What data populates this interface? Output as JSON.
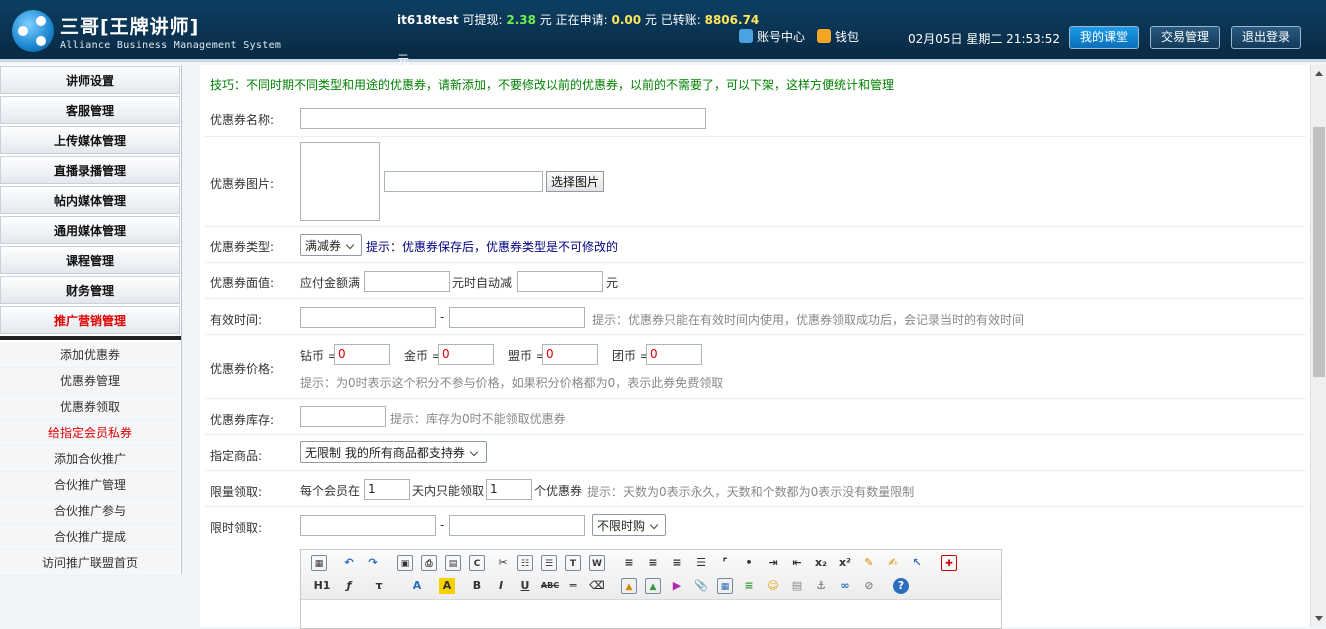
{
  "header": {
    "logo_title": "三哥[王牌讲师]",
    "logo_subtitle": "Alliance Business Management System",
    "username": "it618test",
    "withdraw_label": "可提现:",
    "withdraw_value": "2.38",
    "applying_label": "元 正在申请:",
    "applying_value": "0.00",
    "transferred_label": "元 已转账:",
    "transferred_value": "8806.74",
    "yuan": "元",
    "account_center": "账号中心",
    "wallet": "钱包",
    "date_text": "02月05日 星期二 21:53:52",
    "btn_my_class": "我的课堂",
    "btn_trade": "交易管理",
    "btn_logout": "退出登录"
  },
  "sidebar": {
    "menu": [
      {
        "label": "讲师设置",
        "active": false
      },
      {
        "label": "客服管理",
        "active": false
      },
      {
        "label": "上传媒体管理",
        "active": false
      },
      {
        "label": "直播录播管理",
        "active": false
      },
      {
        "label": "帖内媒体管理",
        "active": false
      },
      {
        "label": "通用媒体管理",
        "active": false
      },
      {
        "label": "课程管理",
        "active": false
      },
      {
        "label": "财务管理",
        "active": false
      },
      {
        "label": "推广营销管理",
        "active": true
      }
    ],
    "sub": [
      {
        "label": "添加优惠券",
        "active": false
      },
      {
        "label": "优惠券管理",
        "active": false
      },
      {
        "label": "优惠券领取",
        "active": false
      },
      {
        "label": "给指定会员私券",
        "active": true
      },
      {
        "label": "添加合伙推广",
        "active": false
      },
      {
        "label": "合伙推广管理",
        "active": false
      },
      {
        "label": "合伙推广参与",
        "active": false
      },
      {
        "label": "合伙推广提成",
        "active": false
      },
      {
        "label": "访问推广联盟首页",
        "active": false
      }
    ]
  },
  "form": {
    "tip": "技巧：不同时期不同类型和用途的优惠券，请新添加，不要修改以前的优惠券，以前的不需要了，可以下架，这样方便统计和管理",
    "name_label": "优惠券名称:",
    "image_label": "优惠券图片:",
    "choose_image": "选择图片",
    "type_label": "优惠券类型:",
    "type_value": "满减券",
    "type_hint": "提示：优惠券保存后，优惠券类型是不可修改的",
    "face_label": "优惠券面值:",
    "face_text1": "应付金额满",
    "face_text2": "元时自动减",
    "face_text3": "元",
    "valid_label": "有效时间:",
    "dash": "-",
    "valid_hint": "提示：优惠券只能在有效时间内使用，优惠券领取成功后，会记录当时的有效时间",
    "price_label": "优惠券价格:",
    "price_items": [
      {
        "label": "钻币 =",
        "value": "0"
      },
      {
        "label": "金币 =",
        "value": "0"
      },
      {
        "label": "盟币 =",
        "value": "0"
      },
      {
        "label": "团币 =",
        "value": "0"
      }
    ],
    "price_hint": "提示：为0时表示这个积分不参与价格，如果积分价格都为0，表示此券免费领取",
    "stock_label": "优惠券库存:",
    "stock_hint": "提示：库存为0时不能领取优惠券",
    "goods_label": "指定商品:",
    "goods_value": "无限制 我的所有商品都支持券",
    "limit_label": "限量领取:",
    "limit_text1": "每个会员在",
    "limit_days": "1",
    "limit_text2": "天内只能领取",
    "limit_count": "1",
    "limit_text3": "个优惠券",
    "limit_hint": "提示：天数为0表示永久，天数和个数都为0表示没有数量限制",
    "timed_label": "限时领取:",
    "timed_select": "不限时购"
  },
  "editor_toolbar": {
    "heading": "H1",
    "bold": "B",
    "italic": "I",
    "underline": "U",
    "strike": "ABC",
    "subscript": "x₂",
    "superscript": "x²"
  }
}
